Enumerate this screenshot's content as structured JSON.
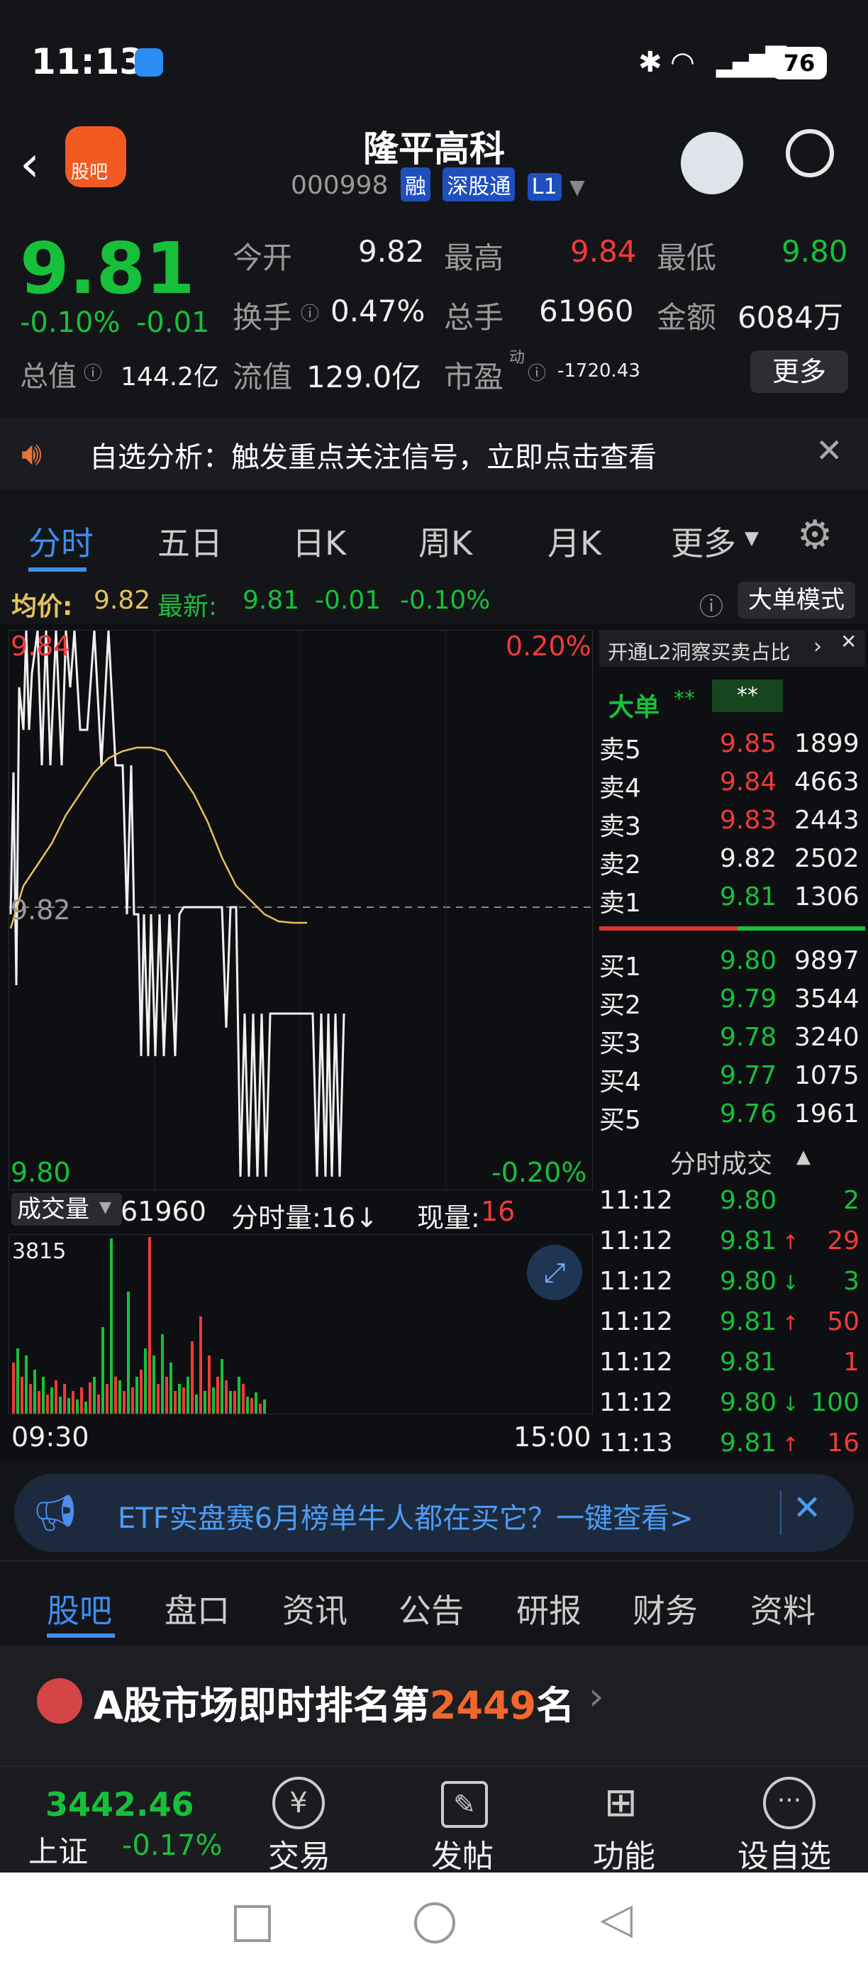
{
  "status": {
    "time": "11:13",
    "battery": "76"
  },
  "header": {
    "title": "隆平高科",
    "code": "000998",
    "tags": [
      "融",
      "深股通",
      "L1"
    ],
    "logo_label": "股吧"
  },
  "quote": {
    "price": "9.81",
    "change_pct": "-0.10%",
    "change": "-0.01",
    "open_label": "今开",
    "open": "9.82",
    "high_label": "最高",
    "high": "9.84",
    "low_label": "最低",
    "low": "9.80",
    "turnover_label": "换手",
    "turnover": "0.47%",
    "volume_label": "总手",
    "volume": "61960",
    "amount_label": "金额",
    "amount": "6084万",
    "mktcap_label": "总值",
    "mktcap": "144.2亿",
    "float_label": "流值",
    "float": "129.0亿",
    "pe_label": "市盈",
    "pe_sup": "动",
    "pe": "-1720.43",
    "more_label": "更多"
  },
  "alert": {
    "text": "自选分析：触发重点关注信号，立即点击查看"
  },
  "tabs": [
    "分时",
    "五日",
    "日K",
    "周K",
    "月K",
    "更多"
  ],
  "chart_info": {
    "avg_label": "均价:",
    "avg": "9.82",
    "latest_label": "最新:",
    "latest": "9.81",
    "chg": "-0.01",
    "chg_pct": "-0.10%",
    "mode_label": "大单模式",
    "top_price": "9.84",
    "mid_price": "9.82",
    "bot_price": "9.80",
    "top_pct": "0.20%",
    "bot_pct": "-0.20%",
    "vol_label": "成交量",
    "vol_total": "61960",
    "minute_vol_label": "分时量:16↓",
    "cur_vol_label": "现量:",
    "cur_vol": "16",
    "vol_max": "3815",
    "time_start": "09:30",
    "time_end": "15:00"
  },
  "orderbook": {
    "promo": "开通L2洞察买卖占比",
    "big_label": "大单",
    "big_v1": "**",
    "big_v2": "**",
    "asks": [
      {
        "label": "卖5",
        "price": "9.85",
        "vol": "1899"
      },
      {
        "label": "卖4",
        "price": "9.84",
        "vol": "4663"
      },
      {
        "label": "卖3",
        "price": "9.83",
        "vol": "2443"
      },
      {
        "label": "卖2",
        "price": "9.82",
        "vol": "2502"
      },
      {
        "label": "卖1",
        "price": "9.81",
        "vol": "1306"
      }
    ],
    "bids": [
      {
        "label": "买1",
        "price": "9.80",
        "vol": "9897"
      },
      {
        "label": "买2",
        "price": "9.79",
        "vol": "3544"
      },
      {
        "label": "买3",
        "price": "9.78",
        "vol": "3240"
      },
      {
        "label": "买4",
        "price": "9.77",
        "vol": "1075"
      },
      {
        "label": "买5",
        "price": "9.76",
        "vol": "1961"
      }
    ],
    "trades_title": "分时成交",
    "trades": [
      {
        "time": "11:12",
        "price": "9.80",
        "dir": "",
        "vol": "2"
      },
      {
        "time": "11:12",
        "price": "9.81",
        "dir": "↑",
        "vol": "29"
      },
      {
        "time": "11:12",
        "price": "9.80",
        "dir": "↓",
        "vol": "3"
      },
      {
        "time": "11:12",
        "price": "9.81",
        "dir": "↑",
        "vol": "50"
      },
      {
        "time": "11:12",
        "price": "9.81",
        "dir": "",
        "vol": "1"
      },
      {
        "time": "11:12",
        "price": "9.80",
        "dir": "↓",
        "vol": "100"
      },
      {
        "time": "11:13",
        "price": "9.81",
        "dir": "↑",
        "vol": "16"
      }
    ]
  },
  "banner": {
    "text": "ETF实盘赛6月榜单牛人都在买它？一键查看>"
  },
  "subtabs": [
    "股吧",
    "盘口",
    "资讯",
    "公告",
    "研报",
    "财务",
    "资料"
  ],
  "rank": {
    "prefix": "A股市场即时排名第",
    "num": "2449",
    "suffix": "名"
  },
  "bottomnav": {
    "index_value": "3442.46",
    "index_name": "上证",
    "index_chg": "-0.17%",
    "items": [
      "交易",
      "发帖",
      "功能",
      "设自选"
    ]
  }
}
